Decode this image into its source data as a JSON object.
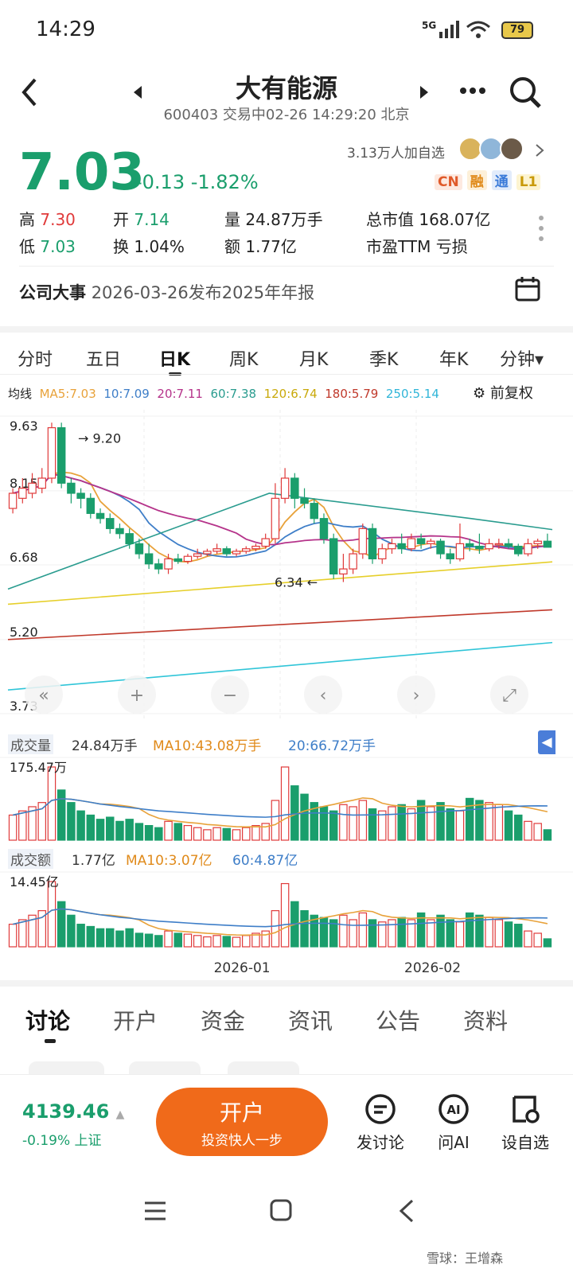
{
  "status": {
    "time": "14:29",
    "network": "5G",
    "battery": "79"
  },
  "header": {
    "title": "大有能源",
    "subtitle": "600403 交易中02-26 14:29:20 北京"
  },
  "followers": "3.13万人加自选",
  "tags": [
    "CN",
    "融",
    "通",
    "L1"
  ],
  "quote": {
    "price": "7.03",
    "change": "-0.13",
    "change_pct": "-1.82%"
  },
  "stats": {
    "high_label": "高",
    "high": "7.30",
    "open_label": "开",
    "open": "7.14",
    "vol_label": "量",
    "vol": "24.87万手",
    "mcap_label": "总市值",
    "mcap": "168.07亿",
    "low_label": "低",
    "low": "7.03",
    "turn_label": "换",
    "turn": "1.04%",
    "amt_label": "额",
    "amt": "1.77亿",
    "pe_label": "市盈TTM",
    "pe": "亏损"
  },
  "event": {
    "label": "公司大事",
    "text": "2026-03-26发布2025年年报"
  },
  "chart_tabs": [
    "分时",
    "五日",
    "日K",
    "周K",
    "月K",
    "季K",
    "年K",
    "分钟"
  ],
  "active_chart_tab": "日K",
  "ma": {
    "label": "均线",
    "ma5": "MA5:7.03",
    "ma10": "10:7.09",
    "ma20": "20:7.11",
    "ma60": "60:7.38",
    "ma120": "120:6.74",
    "ma180": "180:5.79",
    "ma250": "250:5.14",
    "adjust": "前复权"
  },
  "colors": {
    "up": "#e03a3a",
    "down": "#1a9e6c",
    "ma5": "#e8a23a",
    "ma10": "#3e7ec8",
    "ma20": "#b5338a",
    "ma60": "#2a9c8f",
    "ma120": "#e6cf2a",
    "ma180": "#c0392b",
    "ma250": "#30c5d8"
  },
  "volume": {
    "label": "成交量",
    "value": "24.84万手",
    "ma10": "MA10:43.08万手",
    "ma20": "20:66.72万手",
    "max": "175.47万"
  },
  "amount": {
    "label": "成交额",
    "value": "1.77亿",
    "ma10": "MA10:3.07亿",
    "ma60": "60:4.87亿",
    "max": "14.45亿"
  },
  "chart_data": {
    "type": "candlestick",
    "y_ticks": [
      "9.63",
      "8.15",
      "6.68",
      "5.20",
      "3.73"
    ],
    "ylim": [
      3.73,
      9.63
    ],
    "annotations": [
      "9.20",
      "6.34"
    ],
    "x_labels": [
      "2026-01",
      "2026-02"
    ],
    "candles": [
      [
        7.8,
        8.1,
        8.2,
        7.7
      ],
      [
        8.0,
        8.2,
        8.4,
        7.9
      ],
      [
        8.1,
        8.3,
        8.5,
        8.0
      ],
      [
        8.2,
        8.4,
        8.6,
        8.1
      ],
      [
        8.4,
        9.4,
        9.5,
        8.3
      ],
      [
        9.4,
        8.3,
        9.5,
        8.2
      ],
      [
        8.3,
        8.1,
        8.4,
        7.9
      ],
      [
        8.1,
        8.0,
        8.2,
        7.8
      ],
      [
        8.0,
        7.7,
        8.1,
        7.6
      ],
      [
        7.7,
        7.6,
        7.8,
        7.5
      ],
      [
        7.6,
        7.4,
        7.7,
        7.3
      ],
      [
        7.4,
        7.3,
        7.5,
        7.2
      ],
      [
        7.3,
        7.1,
        7.4,
        7.0
      ],
      [
        7.1,
        6.9,
        7.2,
        6.8
      ],
      [
        6.9,
        6.7,
        7.1,
        6.6
      ],
      [
        6.7,
        6.6,
        6.8,
        6.5
      ],
      [
        6.6,
        6.8,
        6.9,
        6.5
      ],
      [
        6.8,
        6.75,
        6.9,
        6.7
      ],
      [
        6.75,
        6.85,
        6.9,
        6.7
      ],
      [
        6.85,
        6.9,
        7.0,
        6.8
      ],
      [
        6.9,
        6.95,
        7.0,
        6.85
      ],
      [
        6.95,
        7.0,
        7.1,
        6.9
      ],
      [
        7.0,
        6.9,
        7.05,
        6.85
      ],
      [
        6.9,
        6.95,
        7.0,
        6.85
      ],
      [
        6.95,
        7.0,
        7.05,
        6.9
      ],
      [
        7.0,
        7.05,
        7.1,
        6.95
      ],
      [
        7.05,
        7.2,
        7.3,
        7.0
      ],
      [
        7.2,
        8.0,
        8.3,
        7.1
      ],
      [
        8.0,
        8.4,
        8.6,
        7.9
      ],
      [
        8.4,
        8.0,
        8.5,
        7.8
      ],
      [
        8.0,
        7.9,
        8.2,
        7.8
      ],
      [
        7.9,
        7.6,
        8.0,
        7.5
      ],
      [
        7.6,
        7.2,
        7.7,
        7.1
      ],
      [
        7.2,
        6.5,
        7.3,
        6.4
      ],
      [
        6.5,
        6.6,
        6.9,
        6.34
      ],
      [
        6.6,
        6.9,
        7.0,
        6.5
      ],
      [
        6.9,
        7.4,
        7.5,
        6.8
      ],
      [
        7.4,
        6.8,
        7.5,
        6.7
      ],
      [
        6.8,
        7.0,
        7.1,
        6.7
      ],
      [
        7.0,
        7.1,
        7.2,
        6.9
      ],
      [
        7.1,
        7.0,
        7.3,
        6.9
      ],
      [
        7.0,
        7.2,
        7.3,
        6.95
      ],
      [
        7.2,
        7.1,
        7.3,
        7.0
      ],
      [
        7.1,
        7.15,
        7.2,
        7.0
      ],
      [
        7.15,
        6.9,
        7.2,
        6.8
      ],
      [
        6.9,
        6.8,
        7.0,
        6.7
      ],
      [
        6.8,
        7.1,
        7.5,
        6.75
      ],
      [
        7.1,
        7.05,
        7.2,
        6.95
      ],
      [
        7.05,
        7.0,
        7.3,
        6.9
      ],
      [
        7.0,
        7.1,
        7.2,
        6.95
      ],
      [
        7.1,
        7.1,
        7.2,
        7.0
      ],
      [
        7.1,
        7.05,
        7.2,
        7.0
      ],
      [
        7.05,
        6.9,
        7.1,
        6.85
      ],
      [
        6.9,
        7.1,
        7.2,
        6.85
      ],
      [
        7.1,
        7.15,
        7.2,
        7.0
      ],
      [
        7.15,
        7.03,
        7.3,
        7.03
      ]
    ],
    "volume_bars": [
      60,
      70,
      80,
      90,
      175,
      120,
      90,
      70,
      60,
      50,
      55,
      45,
      50,
      40,
      35,
      30,
      45,
      40,
      35,
      30,
      25,
      30,
      28,
      25,
      30,
      35,
      40,
      95,
      175,
      130,
      110,
      90,
      80,
      70,
      85,
      80,
      95,
      75,
      70,
      80,
      85,
      75,
      95,
      80,
      90,
      75,
      70,
      100,
      95,
      90,
      85,
      70,
      60,
      45,
      40,
      25
    ],
    "amount_bars": [
      5,
      6,
      7,
      8,
      14.45,
      10,
      7,
      5,
      4.5,
      4,
      4,
      3.5,
      4,
      3,
      2.8,
      2.5,
      3.5,
      3,
      2.8,
      2.5,
      2.2,
      2.5,
      2.3,
      2.1,
      2.5,
      3,
      3.5,
      8,
      14,
      10,
      8,
      7,
      6.5,
      6,
      7,
      6,
      7.5,
      6,
      5.5,
      6,
      6.5,
      6,
      7.5,
      6,
      7,
      6,
      5.5,
      7.5,
      7,
      6.5,
      6,
      5.5,
      5,
      3.5,
      3,
      1.77
    ]
  },
  "bottom_tabs": [
    "讨论",
    "开户",
    "资金",
    "资讯",
    "公告",
    "资料"
  ],
  "footer": {
    "index": "4139.46",
    "index_chg": "-0.19% 上证",
    "open_btn": "开户",
    "open_sub": "投资快人一步",
    "discuss": "发讨论",
    "ai": "问AI",
    "watch": "设自选"
  },
  "watermark": "雪球：王增森"
}
